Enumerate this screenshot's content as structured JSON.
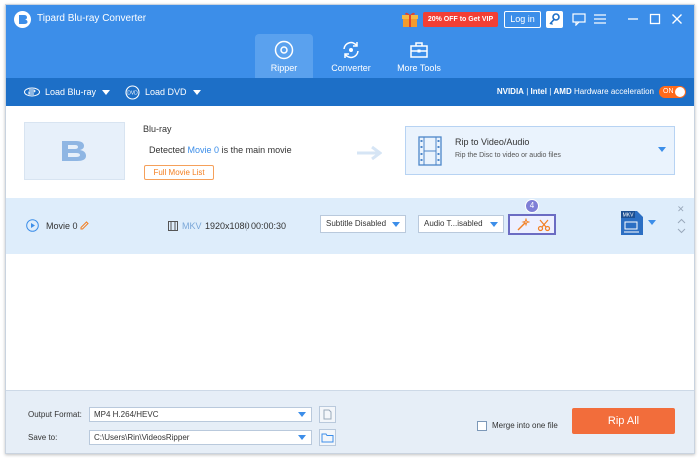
{
  "app": {
    "title": "Tipard Blu-ray Converter"
  },
  "titlebar": {
    "vip_label": "20% OFF to Get VIP",
    "login_label": "Log in",
    "icons": [
      "gift-icon",
      "key-icon",
      "chat-icon",
      "menu-icon",
      "minimize-icon",
      "maximize-icon",
      "close-icon"
    ]
  },
  "nav": {
    "tabs": [
      {
        "label": "Ripper",
        "icon": "ripper-disc-icon",
        "active": true
      },
      {
        "label": "Converter",
        "icon": "converter-icon",
        "active": false
      },
      {
        "label": "More Tools",
        "icon": "toolbox-icon",
        "active": false
      }
    ]
  },
  "toolbar": {
    "load_bluray": "Load Blu-ray",
    "load_dvd": "Load DVD",
    "gpu_nvidia": "NVIDIA",
    "gpu_intel": "Intel",
    "gpu_amd": "AMD",
    "hw_accel": "Hardware acceleration",
    "toggle_label": "ON"
  },
  "source": {
    "title": "Blu-ray",
    "detected_prefix": "Detected",
    "detected_movie": "Movie 0",
    "detected_suffix": "is the main movie",
    "full_list_label": "Full Movie List",
    "rip_title": "Rip to Video/Audio",
    "rip_subtitle": "Rip the Disc to video or audio files"
  },
  "movie": {
    "name": "Movie 0",
    "format": "MKV",
    "resolution": "1920x1080",
    "duration": "00:00:30",
    "subtitle": "Subtitle Disabled",
    "audio": "Audio T...isabled",
    "step_badge": "4",
    "output_format_icon": "MKV"
  },
  "footer": {
    "output_format_label": "Output Format:",
    "output_format_value": "MP4 H.264/HEVC",
    "save_to_label": "Save to:",
    "save_to_value": "C:\\Users\\Rin\\VideosRipper",
    "merge_label": "Merge into one file",
    "rip_all_label": "Rip All"
  },
  "colors": {
    "titlebar": "#3c8ee9",
    "toolbar": "#1d6fc7",
    "accent_orange": "#f26d3b",
    "vip_red": "#f23f35",
    "highlight_purple": "#6b6cc3"
  }
}
